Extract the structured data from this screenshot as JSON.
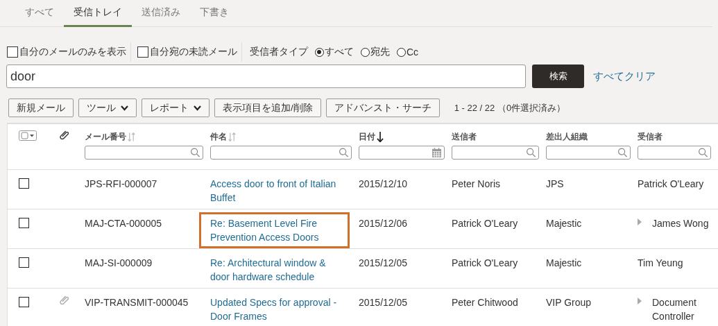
{
  "tabs": [
    {
      "label": "すべて",
      "selected": false
    },
    {
      "label": "受信トレイ",
      "selected": true
    },
    {
      "label": "送信済み",
      "selected": false
    },
    {
      "label": "下書き",
      "selected": false
    }
  ],
  "filters": {
    "checkboxes": [
      {
        "label": "自分のメールのみを表示",
        "checked": false
      },
      {
        "label": "自分宛の未読メール",
        "checked": false
      }
    ],
    "recipient_type": {
      "label": "受信者タイプ",
      "options": [
        {
          "label": "すべて",
          "selected": true
        },
        {
          "label": "宛先",
          "selected": false
        },
        {
          "label": "Cc",
          "selected": false
        }
      ]
    }
  },
  "search": {
    "value": "door",
    "button": "検索",
    "clear_link": "すべてクリア"
  },
  "toolbar": {
    "buttons": [
      {
        "label": "新規メール",
        "kind": "plain"
      },
      {
        "label": "ツール",
        "kind": "dropdown"
      },
      {
        "label": "レポート",
        "kind": "dropdown"
      },
      {
        "label": "表示項目を追加/削除",
        "kind": "plain"
      },
      {
        "label": "アドバンスト・サーチ",
        "kind": "plain"
      }
    ],
    "count": "1 - 22 / 22 （0件選択済み）"
  },
  "table": {
    "columns": [
      {
        "label": "メール番号",
        "kind": "text",
        "sortable": true,
        "sorted": false
      },
      {
        "label": "件名",
        "kind": "text",
        "sortable": true,
        "sorted": false
      },
      {
        "label": "日付",
        "kind": "date",
        "sortable": true,
        "sorted": true
      },
      {
        "label": "送信者",
        "kind": "text",
        "sortable": false,
        "sorted": false
      },
      {
        "label": "差出人組織",
        "kind": "text",
        "sortable": false,
        "sorted": false
      },
      {
        "label": "受信者",
        "kind": "text",
        "sortable": false,
        "sorted": false
      }
    ],
    "rows": [
      {
        "checked": false,
        "attachment": false,
        "number": "JPS-RFI-000007",
        "subject": "Access door to front of Italian Buffet",
        "highlighted": false,
        "date": "2015/12/10",
        "sender": "Peter Noris",
        "organization": "JPS",
        "recipient": "Patrick O'Leary",
        "expandable": false
      },
      {
        "checked": false,
        "attachment": false,
        "number": "MAJ-CTA-000005",
        "subject": "Re: Basement Level Fire Prevention Access Doors",
        "highlighted": true,
        "date": "2015/12/06",
        "sender": "Patrick O'Leary",
        "organization": "Majestic",
        "recipient": "James Wong",
        "expandable": true
      },
      {
        "checked": false,
        "attachment": false,
        "number": "MAJ-SI-000009",
        "subject": "Re: Architectural window & door hardware schedule",
        "highlighted": false,
        "date": "2015/12/05",
        "sender": "Patrick O'Leary",
        "organization": "Majestic",
        "recipient": "Tim Yeung",
        "expandable": false
      },
      {
        "checked": false,
        "attachment": true,
        "number": "VIP-TRANSMIT-000045",
        "subject": "Updated Specs for approval - Door Frames",
        "highlighted": false,
        "date": "2015/12/05",
        "sender": "Peter Chitwood",
        "organization": "VIP Group",
        "recipient": "Document Controller",
        "expandable": true
      }
    ]
  }
}
